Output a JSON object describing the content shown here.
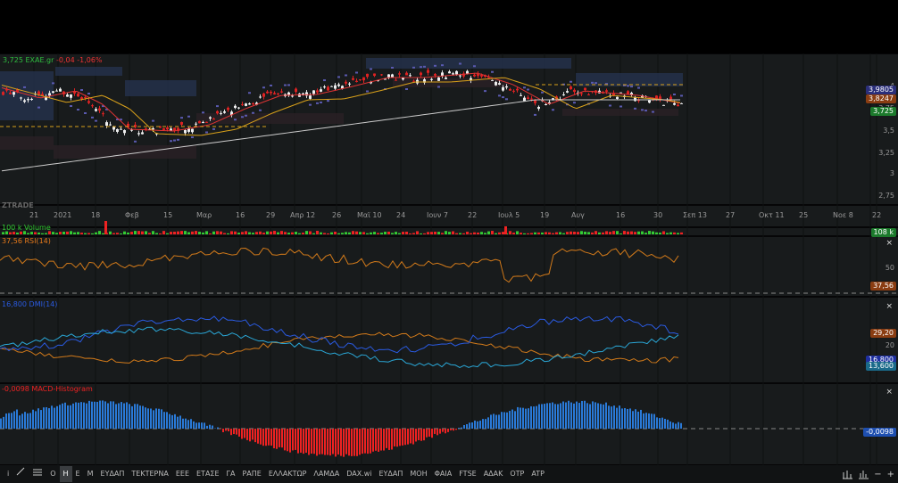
{
  "header": {
    "price": "3,725",
    "symbol": "ΕΧΑΕ.gr",
    "change": "-0,04",
    "change_pct": "-1,06%"
  },
  "watermark": "ZTRADE",
  "price_axis": [
    "4",
    "3,75",
    "3,5",
    "3,25",
    "3",
    "2,75"
  ],
  "price_badges": [
    {
      "text": "3,9805",
      "color": "#2b2f7a"
    },
    {
      "text": "3,8247",
      "color": "#8a3d12"
    },
    {
      "text": "3,725",
      "color": "#1c7a2c"
    }
  ],
  "time_axis": [
    "21",
    "2021",
    "18",
    "Φεβ",
    "15",
    "Μαρ",
    "16",
    "29",
    "Απρ 12",
    "26",
    "Μαϊ 10",
    "24",
    "Ιουν 7",
    "22",
    "Ιουλ 5",
    "19",
    "Αυγ",
    "16",
    "30",
    "Σεπ 13",
    "27",
    "Οκτ 11",
    "25",
    "Νοε 8",
    "22"
  ],
  "volume": {
    "label": "100 k Volume",
    "badge": "108 k"
  },
  "rsi": {
    "label": "37,56 RSI(14)",
    "axis": "50",
    "badge": "37,56",
    "close": "×"
  },
  "dmi": {
    "label": "16,800 DMI(14)",
    "axis": "20",
    "badges": [
      "29,20",
      "16,800",
      "13,600"
    ],
    "close": "×"
  },
  "macd": {
    "label": "-0,0098 MACD-Histogram",
    "badge": "-0,0098",
    "close": "×"
  },
  "toolbar": {
    "items": [
      "Ο",
      "Η",
      "Ε",
      "Μ",
      "ΕΥΔΑΠ",
      "ΤΕΚΤΕΡΝΑ",
      "ΕΕΕ",
      "ΕΤΑΣΕ",
      "ΓΑ",
      "ΡΑΠΕ",
      "ΕΛΛΑΚΤΩΡ",
      "ΛΑΜΔΑ",
      "DAX.wi",
      "ΕΥΔΑΠ",
      "ΜΟΗ",
      "ΦΑΙΑ",
      "FTSE",
      "ΑΔΑΚ",
      "ΟΤΡ",
      "ATP"
    ],
    "active": 1,
    "info": "i",
    "minus": "−",
    "plus": "+"
  }
}
